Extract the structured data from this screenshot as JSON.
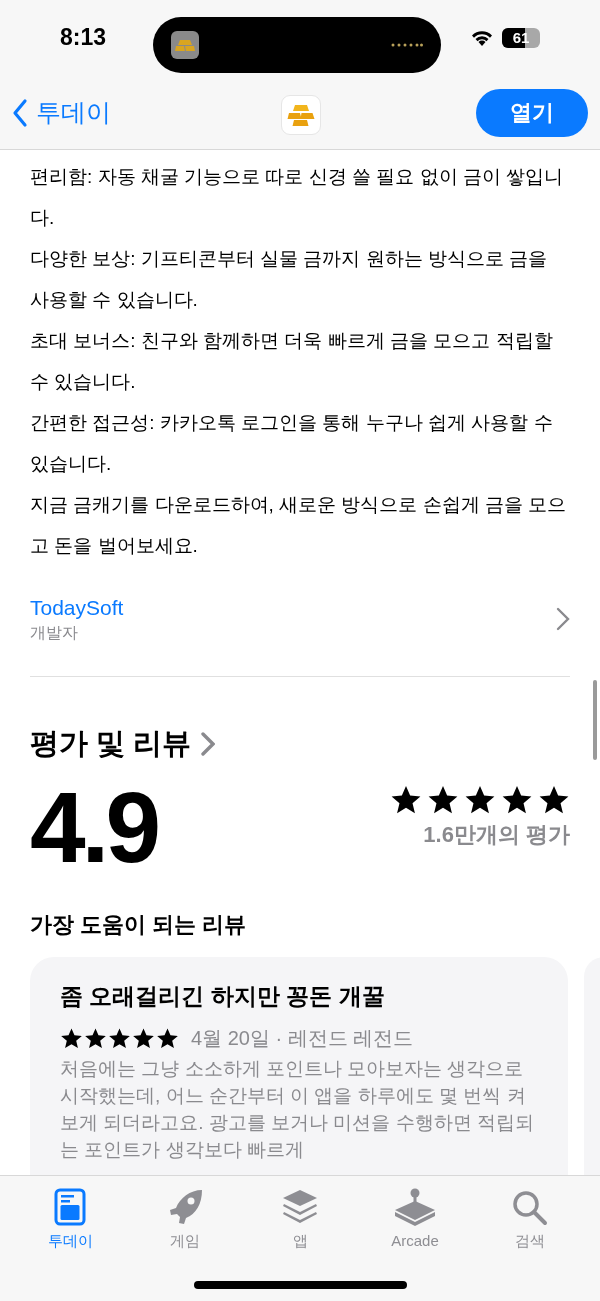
{
  "status_bar": {
    "time": "8:13",
    "battery": "61"
  },
  "nav": {
    "back_label": "투데이",
    "open_button": "열기"
  },
  "description": [
    "편리함: 자동 채굴 기능으로 따로 신경 쓸 필요 없이 금이 쌓입니다.",
    "다양한 보상: 기프티콘부터 실물 금까지 원하는 방식으로 금을 사용할 수 있습니다.",
    "초대 보너스: 친구와 함께하면 더욱 빠르게 금을 모으고 적립할 수 있습니다.",
    "간편한 접근성: 카카오톡 로그인을 통해 누구나 쉽게 사용할 수 있습니다.",
    "지금 금캐기를 다운로드하여, 새로운 방식으로 손쉽게 금을 모으고 돈을 벌어보세요."
  ],
  "developer": {
    "name": "TodaySoft",
    "label": "개발자"
  },
  "ratings": {
    "title": "평가 및 리뷰",
    "score": "4.9",
    "stars": 5,
    "count": "1.6만개의 평가"
  },
  "reviews_title": "가장 도움이 되는 리뷰",
  "reviews": [
    {
      "title": "좀 오래걸리긴 하지만 꽁돈 개꿀",
      "stars": 5,
      "meta": "4월 20일 · 레전드 레전드",
      "body": "처음에는 그냥 소소하게 포인트나 모아보자는 생각으로 시작했는데, 어느 순간부터 이 앱을 하루에도 몇 번씩 켜보게 되더라고요. 광고를 보거나 미션을 수행하면 적립되는 포인트가 생각보다 빠르게"
    }
  ],
  "tabs": [
    {
      "label": "투데이",
      "kind": "today",
      "selected": true
    },
    {
      "label": "게임",
      "kind": "games",
      "selected": false
    },
    {
      "label": "앱",
      "kind": "apps",
      "selected": false
    },
    {
      "label": "Arcade",
      "kind": "arcade",
      "selected": false
    },
    {
      "label": "검색",
      "kind": "search",
      "selected": false
    }
  ]
}
